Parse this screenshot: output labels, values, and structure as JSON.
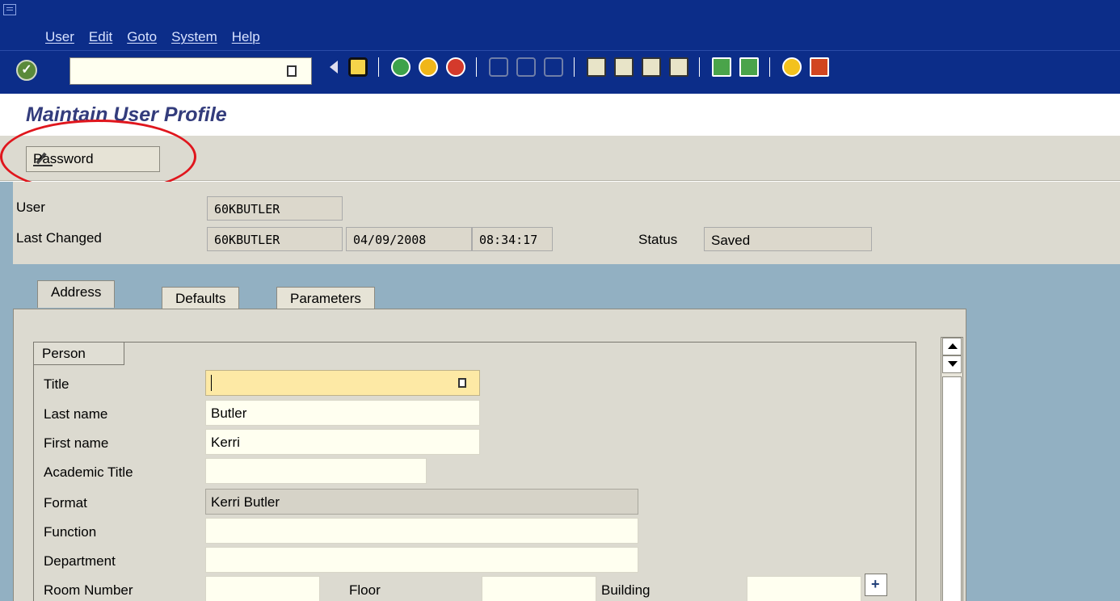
{
  "menu": {
    "items": [
      "User",
      "Edit",
      "Goto",
      "System",
      "Help"
    ]
  },
  "toolbar": {
    "command_value": ""
  },
  "page": {
    "title": "Maintain User Profile"
  },
  "apptoolbar": {
    "password_label": "Password"
  },
  "header": {
    "user_label": "User",
    "user_value": "60KBUTLER",
    "last_changed_label": "Last Changed",
    "last_changed_by": "60KBUTLER",
    "last_changed_date": "04/09/2008",
    "last_changed_time": "08:34:17",
    "status_label": "Status",
    "status_value": "Saved"
  },
  "tabs": [
    {
      "label": "Address",
      "active": true
    },
    {
      "label": "Defaults",
      "active": false
    },
    {
      "label": "Parameters",
      "active": false
    }
  ],
  "person": {
    "group_title": "Person",
    "fields": [
      {
        "label": "Title",
        "value": ""
      },
      {
        "label": "Last name",
        "value": "Butler"
      },
      {
        "label": "First name",
        "value": "Kerri"
      },
      {
        "label": "Academic Title",
        "value": ""
      },
      {
        "label": "Format",
        "value": "Kerri Butler"
      },
      {
        "label": "Function",
        "value": ""
      },
      {
        "label": "Department",
        "value": ""
      },
      {
        "label": "Room Number",
        "value": ""
      }
    ],
    "floor_label": "Floor",
    "floor_value": "",
    "building_label": "Building",
    "building_value": ""
  }
}
